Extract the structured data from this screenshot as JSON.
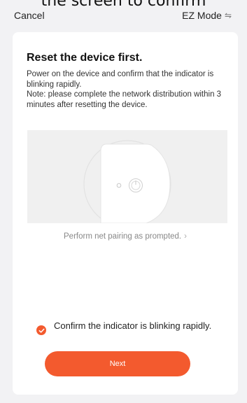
{
  "caption": "the screen to confirm",
  "nav": {
    "cancel_label": "Cancel",
    "mode_label": "EZ Mode",
    "mode_icon": "swap-icon"
  },
  "card": {
    "title": "Reset the device first.",
    "description_line1": "Power on the device and confirm that the indicator is blinking rapidly.",
    "description_line2": "Note: please complete the network distribution within 3 minutes after resetting the device.",
    "link_text": "Perform net pairing as prompted.",
    "confirm_text": "Confirm the indicator is blinking rapidly.",
    "confirm_checked": true,
    "next_label": "Next"
  },
  "colors": {
    "accent": "#f35a2e",
    "background": "#f2f2f4",
    "card": "#ffffff"
  }
}
